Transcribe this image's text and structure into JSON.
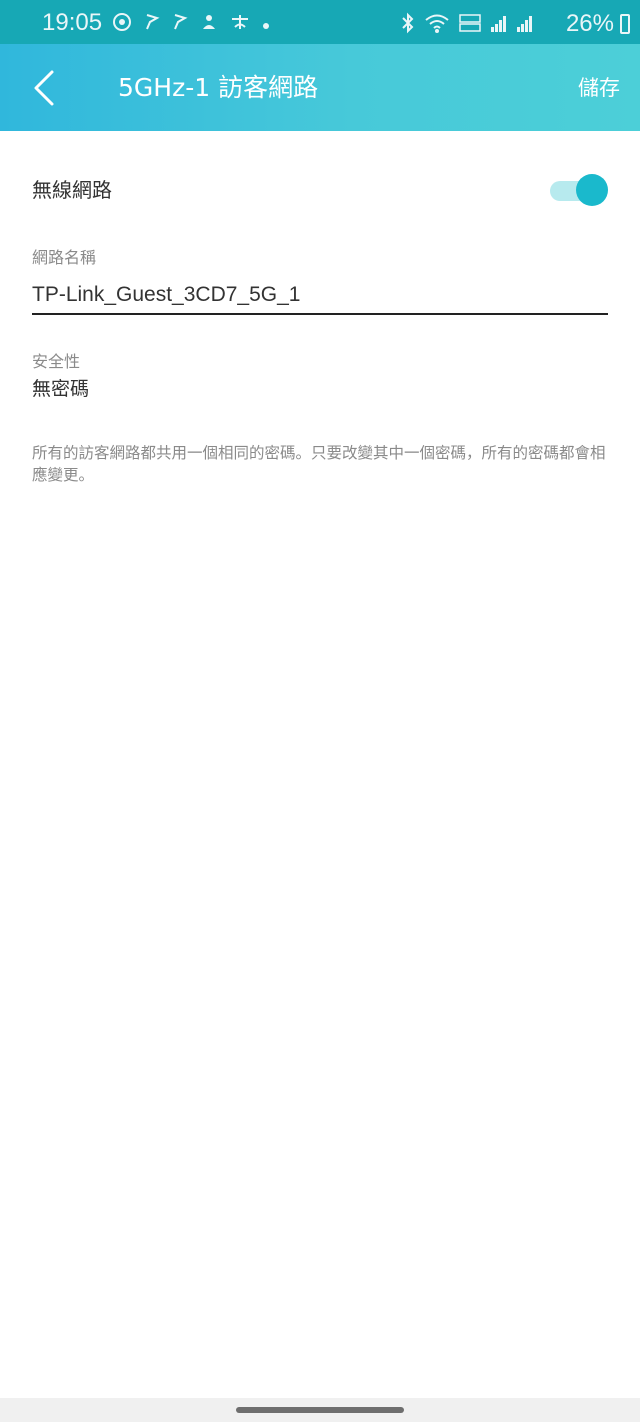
{
  "status_bar": {
    "time": "19:05",
    "battery": "26%",
    "left_icons": [
      "whatsapp-icon",
      "flag-icon",
      "flag-icon",
      "app-icon",
      "app-icon",
      "dot-icon"
    ],
    "right_icons": [
      "bluetooth-icon",
      "wifi-icon",
      "volte-icon",
      "signal-icon",
      "signal-icon"
    ]
  },
  "app_bar": {
    "title": "5GHz-1 訪客網路",
    "save_label": "儲存"
  },
  "wifi": {
    "label": "無線網路",
    "enabled": true
  },
  "ssid": {
    "label": "網路名稱",
    "value": "TP-Link_Guest_3CD7_5G_1"
  },
  "security": {
    "label": "安全性",
    "value": "無密碼"
  },
  "note": "所有的訪客網路都共用一個相同的密碼。只要改變其中一個密碼，所有的密碼都會相應變更。",
  "colors": {
    "status_bar": "#17a8b5",
    "app_bar_start": "#30b7dc",
    "app_bar_end": "#4ccfd8",
    "toggle_on": "#1ab9cc",
    "toggle_track": "#b7eaee"
  }
}
